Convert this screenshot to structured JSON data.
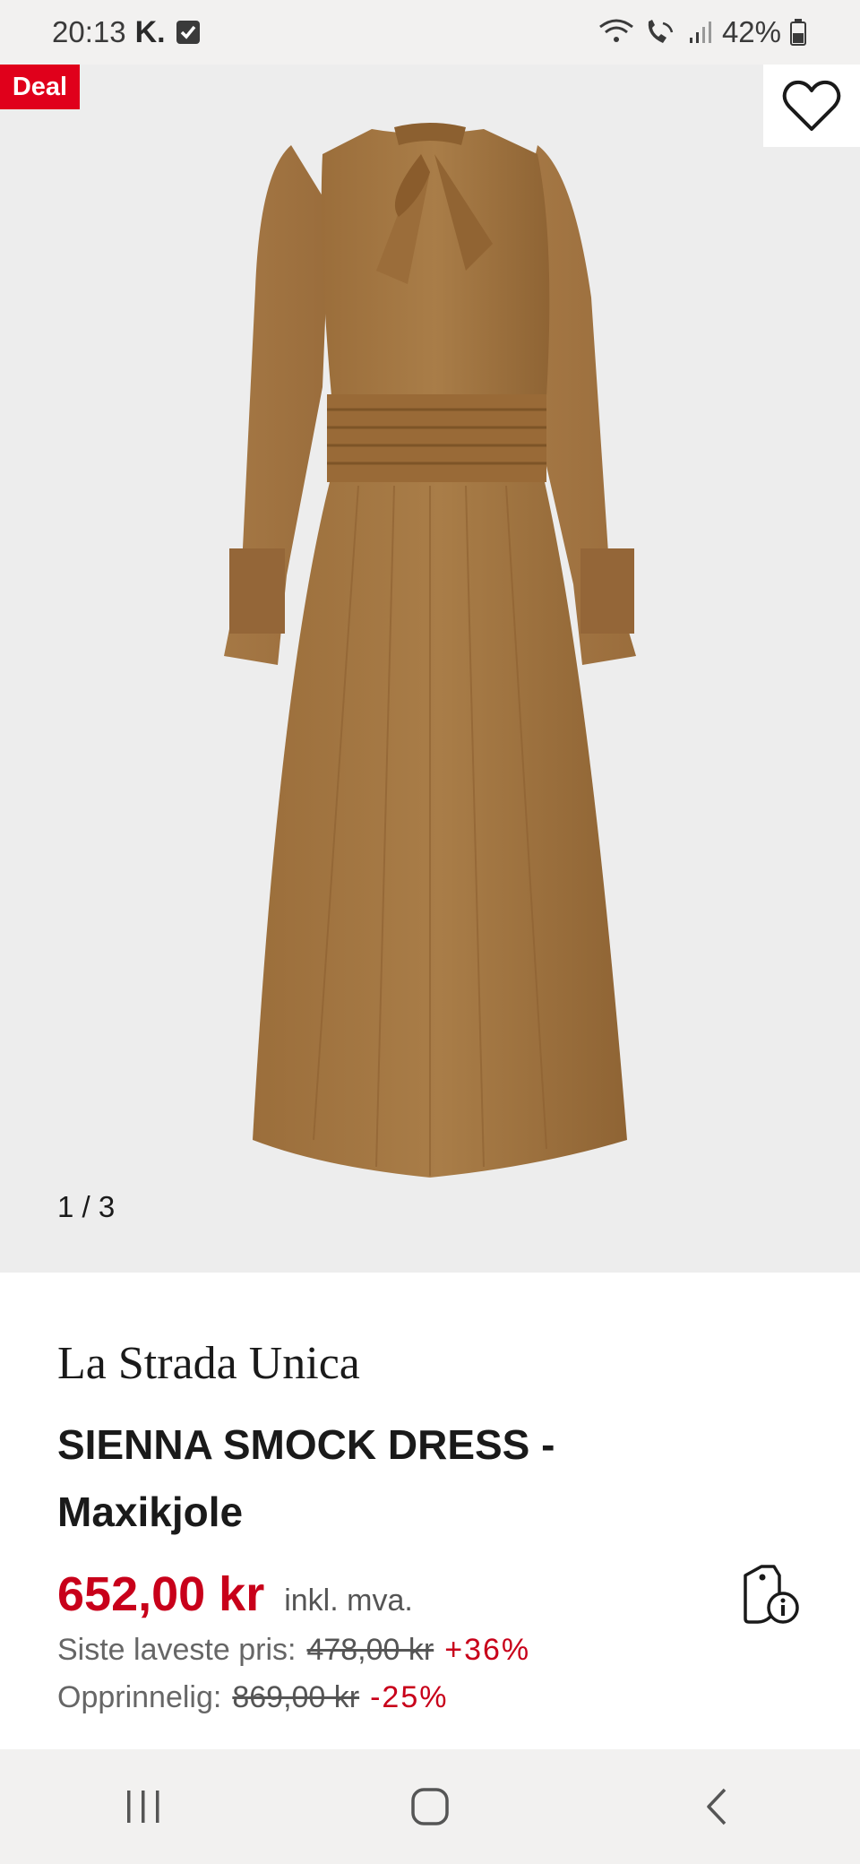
{
  "status_bar": {
    "time": "20:13",
    "app_glyph": "K.",
    "battery": "42%",
    "icons": [
      "check-box-icon",
      "wifi-icon",
      "wifi-call-icon",
      "signal-icon",
      "battery-icon"
    ]
  },
  "gallery": {
    "deal_label": "Deal",
    "counter": "1 / 3",
    "image_subject": "brown long-sleeve smock midi dress with neck tie bow"
  },
  "product": {
    "brand": "La Strada Unica",
    "title_line1": "SIENNA SMOCK DRESS -",
    "title_line2": "Maxikjole",
    "price": "652,00 kr",
    "vat_note": "inkl. mva.",
    "lowest_label": "Siste laveste pris:",
    "lowest_price": "478,00 kr",
    "lowest_change": "+36%",
    "original_label": "Opprinnelig:",
    "original_price": "869,00 kr",
    "original_change": "-25%"
  },
  "colors": {
    "accent_red": "#c8001a",
    "deal_red": "#e0001b",
    "dress_brown": "#a67a45"
  },
  "nav": {
    "icons": [
      "recents-icon",
      "home-icon",
      "back-icon"
    ]
  }
}
